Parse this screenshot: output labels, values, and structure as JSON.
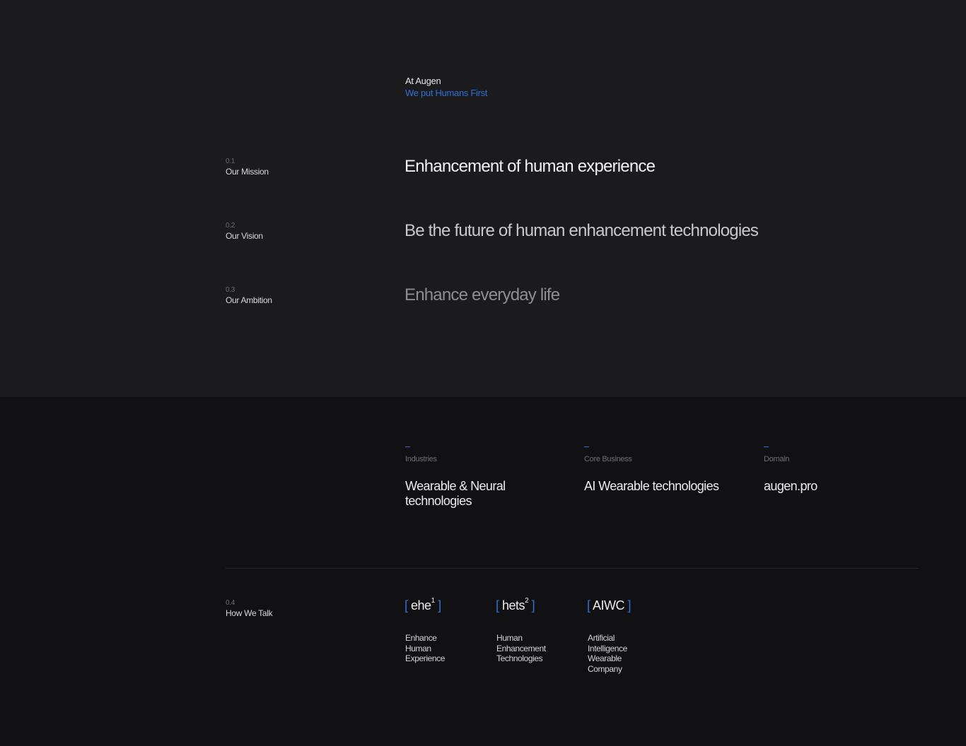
{
  "intro": {
    "line1": "At Augen",
    "line2": "We put Humans First"
  },
  "rows": [
    {
      "num": "0.1",
      "label": "Our Mission",
      "text": "Enhancement of human experience"
    },
    {
      "num": "0.2",
      "label": "Our Vision",
      "text": "Be the future of human enhancement technologies"
    },
    {
      "num": "0.3",
      "label": "Our Ambition",
      "text": "Enhance everyday life"
    }
  ],
  "info": [
    {
      "label": "Industries",
      "value": "Wearable & Neural\ntechnologies"
    },
    {
      "label": "Core Business",
      "value": "AI Wearable technologies"
    },
    {
      "label": "Domain",
      "value": "augen.pro"
    }
  ],
  "talk": {
    "num": "0.4",
    "label": "How We Talk",
    "terms": [
      {
        "open": "[",
        "term": "ehe",
        "sup": "1",
        "close": "]",
        "desc": "Enhance\nHuman\nExperience"
      },
      {
        "open": "[",
        "term": "hets",
        "sup": "2",
        "close": "]",
        "desc": "Human\nEnhancement\nTechnologies"
      },
      {
        "open": "[",
        "term": "AIWC",
        "sup": "",
        "close": "]",
        "desc": "Artificial\nIntelligence\nWearable\nCompany"
      }
    ]
  },
  "colors": {
    "accent": "#2f6fd6",
    "top_bg": "#1b1b1d",
    "bottom_bg": "#111113"
  }
}
